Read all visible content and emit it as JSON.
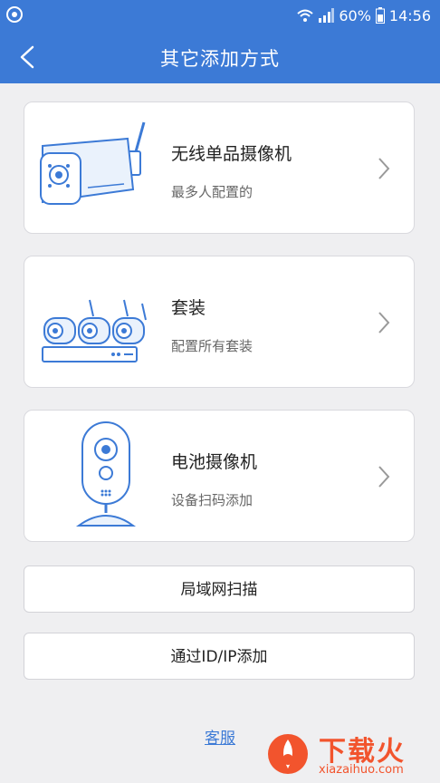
{
  "status_bar": {
    "battery": "60%",
    "time": "14:56",
    "icons": [
      "app-notification-icon",
      "wifi-icon",
      "signal-icon",
      "battery-icon"
    ]
  },
  "header": {
    "title": "其它添加方式"
  },
  "options": [
    {
      "title": "无线单品摄像机",
      "subtitle": "最多人配置的",
      "icon": "wireless-camera-icon"
    },
    {
      "title": "套装",
      "subtitle": "配置所有套装",
      "icon": "camera-kit-icon"
    },
    {
      "title": "电池摄像机",
      "subtitle": "设备扫码添加",
      "icon": "battery-camera-icon"
    }
  ],
  "buttons": {
    "lan_scan": "局域网扫描",
    "add_by_ip": "通过ID/IP添加"
  },
  "footer": {
    "service_link": "客服"
  },
  "watermark": {
    "brand": "下载火",
    "url": "xiazaihuo.com"
  },
  "colors": {
    "primary": "#3c7ad6",
    "background": "#efeff1",
    "watermark": "#f2542d"
  }
}
